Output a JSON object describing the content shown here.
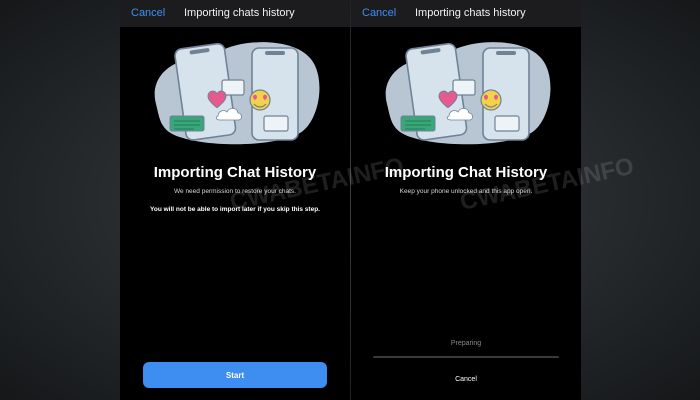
{
  "screens": [
    {
      "nav": {
        "cancel_label": "Cancel",
        "title": "Importing chats history"
      },
      "heading": "Importing Chat History",
      "subtext": "We need permission to restore your chats.",
      "warning": "You will not be able to import later if you skip this step.",
      "start_label": "Start"
    },
    {
      "nav": {
        "cancel_label": "Cancel",
        "title": "Importing chats history"
      },
      "heading": "Importing Chat History",
      "subtext": "Keep your phone unlocked and this app open.",
      "status": "Preparing",
      "progress": 0,
      "cancel_label": "Cancel"
    }
  ],
  "watermark": "CWABETAINFO",
  "colors": {
    "accent": "#3d8ef0",
    "background": "#000000",
    "nav_bar": "#1c1c1e",
    "illustration_blob": "#b8c6d4",
    "phone": "#d6e2ec",
    "heart": "#e85a8e",
    "emoji": "#f2d24b",
    "chat_bubble_green": "#3aa77a"
  },
  "icons": [
    "phone-illustration",
    "heart-icon",
    "heart-eyes-emoji-icon",
    "cloud-icon",
    "chat-bubble-icon"
  ]
}
